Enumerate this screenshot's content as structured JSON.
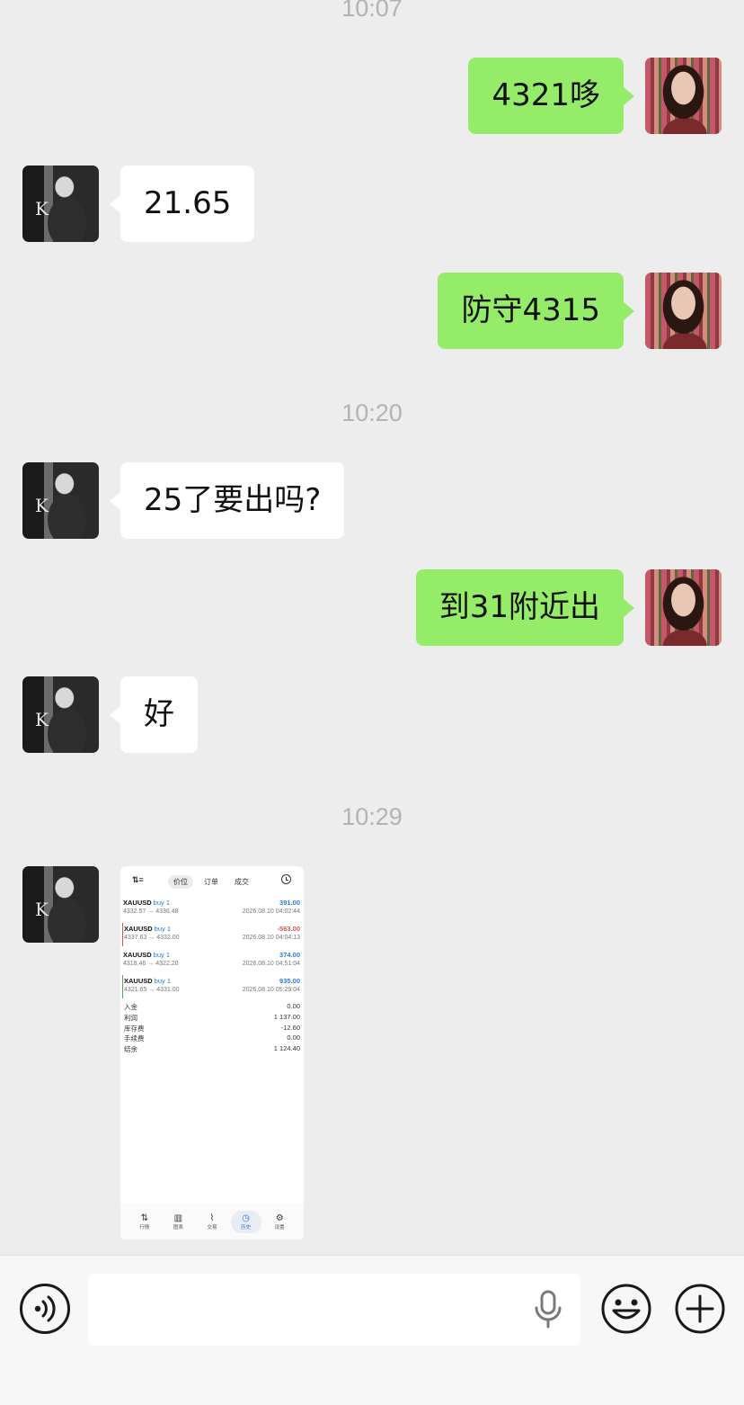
{
  "timestamps": [
    "10:07",
    "10:20",
    "10:29"
  ],
  "messages": [
    {
      "sender": "me",
      "text": "4321哆"
    },
    {
      "sender": "them",
      "text": "21.65"
    },
    {
      "sender": "me",
      "text": "防守4315"
    },
    {
      "sender": "them",
      "text": "25了要出吗?"
    },
    {
      "sender": "me",
      "text": "到31附近出"
    },
    {
      "sender": "them",
      "text": "好"
    }
  ],
  "avatars": {
    "them_initial": "K"
  },
  "image_message": {
    "tabs": [
      "价位",
      "订单",
      "成交"
    ],
    "active_tab": "价位",
    "trades": [
      {
        "symbol": "XAUUSD",
        "side": "buy 1",
        "profit": "391.00",
        "prices": "4332.57 → 4336.48",
        "time": "2026.08.10 04:02:44",
        "marker": "none"
      },
      {
        "symbol": "XAUUSD",
        "side": "buy 1",
        "profit": "-563.00",
        "prices": "4337.63 → 4332.00",
        "time": "2026.08.10 04:04:13",
        "marker": "red"
      },
      {
        "symbol": "XAUUSD",
        "side": "buy 1",
        "profit": "374.00",
        "prices": "4318.46 → 4322.20",
        "time": "2026.08.10 04:51:04",
        "marker": "none"
      },
      {
        "symbol": "XAUUSD",
        "side": "buy 1",
        "profit": "935.00",
        "prices": "4321.65 → 4331.00",
        "time": "2026.08.10 05:29:04",
        "marker": "green"
      }
    ],
    "summary": [
      {
        "label": "入金",
        "value": "0.00"
      },
      {
        "label": "利润",
        "value": "1 137.00"
      },
      {
        "label": "库存费",
        "value": "-12.60"
      },
      {
        "label": "手续费",
        "value": "0.00"
      },
      {
        "label": "结余",
        "value": "1 124.40"
      }
    ],
    "bottom_tabs": [
      {
        "label": "行情",
        "icon": "quotes-icon"
      },
      {
        "label": "图表",
        "icon": "chart-icon"
      },
      {
        "label": "交易",
        "icon": "trade-icon"
      },
      {
        "label": "历史",
        "icon": "history-icon"
      },
      {
        "label": "设置",
        "icon": "settings-icon"
      }
    ],
    "active_bottom_tab": "历史"
  },
  "input_bar": {
    "value": "",
    "placeholder": ""
  },
  "colors": {
    "me_bubble": "#95ec69",
    "them_bubble": "#ffffff",
    "background": "#ededed",
    "profit_blue": "#2a7ad6",
    "loss_red": "#d9534f"
  }
}
